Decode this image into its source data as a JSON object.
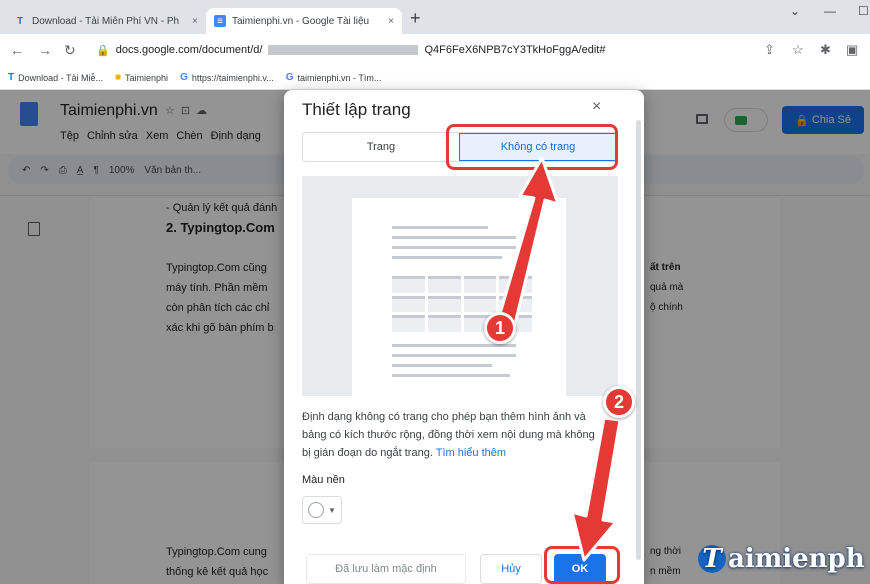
{
  "browser": {
    "tabs": [
      {
        "label": "Download - Tải Miễn Phí VN - Ph",
        "close": "×"
      },
      {
        "label": "Taimienphi.vn - Google Tài liệu",
        "close": "×"
      }
    ],
    "new_tab": "+",
    "url_prefix": "docs.google.com/document/d/",
    "url_suffix": "Q4F6FeX6NPB7cY3TkHoFggA/edit#",
    "bookmarks": [
      {
        "icon": "T",
        "label": "Download - Tải Miễ..."
      },
      {
        "icon": "■",
        "label": "Taimienphi"
      },
      {
        "icon": "G",
        "label": "https://taimienphi.v..."
      },
      {
        "icon": "G",
        "label": "taimienphi.vn - Tìm..."
      }
    ]
  },
  "docs": {
    "title": "Taimienphi.vn",
    "menu": [
      "Tệp",
      "Chỉnh sửa",
      "Xem",
      "Chèn",
      "Định dạng"
    ],
    "share": "Chia Sẻ",
    "zoom": "100%",
    "style": "Văn bản th...",
    "body": [
      "- Quản lý kết quả đánh",
      "2. Typingtop.Com",
      "Typingtop.Com cũng",
      "máy tính. Phần mềm",
      "còn phân tích các chỉ",
      "xác khi gõ bàn phím b"
    ],
    "body_right": [
      "ất trên",
      "quả mà",
      "ộ chính"
    ],
    "page2": [
      "Typingtop.Com cung",
      "thống kê kết quả học"
    ],
    "page2_right": [
      "ng thời",
      "n mềm"
    ]
  },
  "dialog": {
    "title": "Thiết lập trang",
    "close": "×",
    "tab_page": "Trang",
    "tab_pageless": "Không có trang",
    "description": "Định dạng không có trang cho phép bạn thêm hình ảnh và bảng có kích thước rộng, đồng thời xem nội dung mà không bị gián đoạn do ngắt trang.",
    "learn_more": "Tìm hiểu thêm",
    "bg_label": "Màu nền",
    "btn_default": "Đã lưu làm mặc định",
    "btn_cancel": "Hủy",
    "btn_ok": "OK"
  },
  "annotations": {
    "step1": "1",
    "step2": "2",
    "color": "#e53935"
  },
  "watermark": {
    "letter": "T",
    "text": "aimienph"
  }
}
